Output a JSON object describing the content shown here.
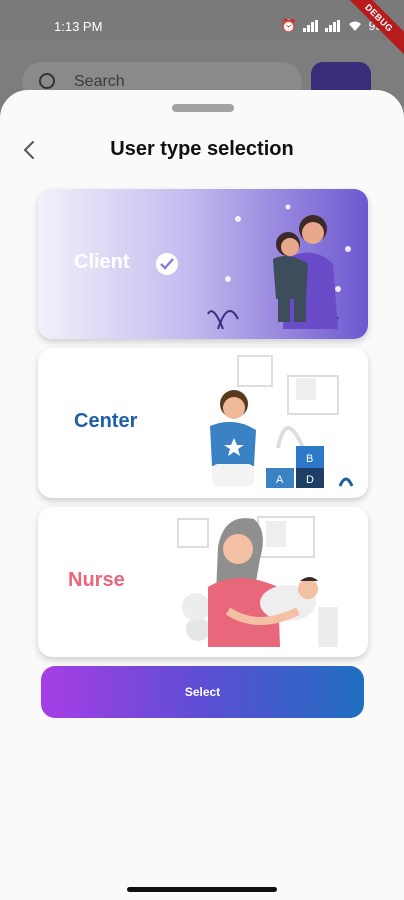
{
  "status_bar": {
    "time": "1:13 PM",
    "battery": "93"
  },
  "debug_banner": "DEBUG",
  "background": {
    "search_placeholder": "Search"
  },
  "sheet": {
    "title": "User type selection",
    "options": [
      {
        "label": "Client",
        "selected": true,
        "color": "#ffffff"
      },
      {
        "label": "Center",
        "selected": false,
        "color": "#1e5fa8"
      },
      {
        "label": "Nurse",
        "selected": false,
        "color": "#e8677a"
      }
    ],
    "select_label": "Select"
  },
  "colors": {
    "accent_purple": "#6d58d0",
    "button_start": "#a63ee6",
    "button_end": "#1f6fc0"
  }
}
